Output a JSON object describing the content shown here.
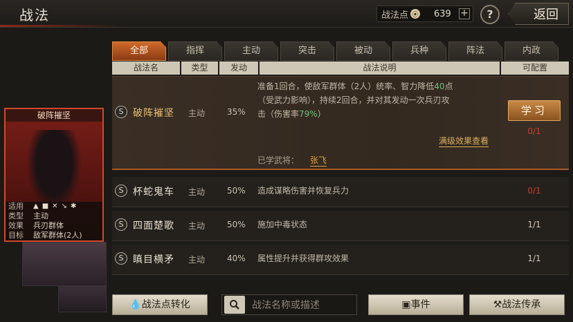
{
  "header": {
    "title": "战法",
    "points_label": "战法点",
    "points_value": "639",
    "plus_label": "+",
    "help_label": "?",
    "back_label": "返回"
  },
  "tabs": [
    "全部",
    "指挥",
    "主动",
    "突击",
    "被动",
    "兵种",
    "阵法",
    "内政"
  ],
  "columns": [
    "战法名",
    "类型",
    "发动",
    "战法说明",
    "可配置"
  ],
  "selected": {
    "grade": "S",
    "name": "破阵摧坚",
    "type": "主动",
    "rate": "35%",
    "desc_1": "准备1回合，使敌军群体（2人）统率、智力降低",
    "desc_1_hl": "40",
    "desc_1_end": "点",
    "desc_2": "（受武力影响），持续2回合，并对其发动一次兵刃攻",
    "desc_3": "击（伤害率",
    "desc_3_hl": "79%",
    "desc_3_end": "）",
    "learn_label": "学习",
    "slot": "0/1",
    "max_effect_label": "满级效果查看",
    "learned_label": "已学武将：",
    "learned_general": "张飞"
  },
  "skills": [
    {
      "grade": "S",
      "name": "杯蛇鬼车",
      "type": "主动",
      "rate": "50%",
      "desc": "造成谋略伤害并恢复兵力",
      "slot": "0/1"
    },
    {
      "grade": "S",
      "name": "四面楚歌",
      "type": "主动",
      "rate": "50%",
      "desc": "施加中毒状态",
      "slot": "1/1"
    },
    {
      "grade": "S",
      "name": "瞋目横矛",
      "type": "主动",
      "rate": "40%",
      "desc": "属性提升并获得群攻效果",
      "slot": "1/1"
    }
  ],
  "card": {
    "title": "破阵摧坚",
    "suit_label": "适用",
    "type_label": "类型",
    "type_value": "主动",
    "effect_label": "效果",
    "effect_value": "兵刃群体",
    "target_label": "目标",
    "target_value": "敌军群体(2人)"
  },
  "bottom": {
    "convert_label": "战法点转化",
    "search_placeholder": "战法名称或描述",
    "event_label": "事件",
    "inherit_label": "战法传承"
  }
}
